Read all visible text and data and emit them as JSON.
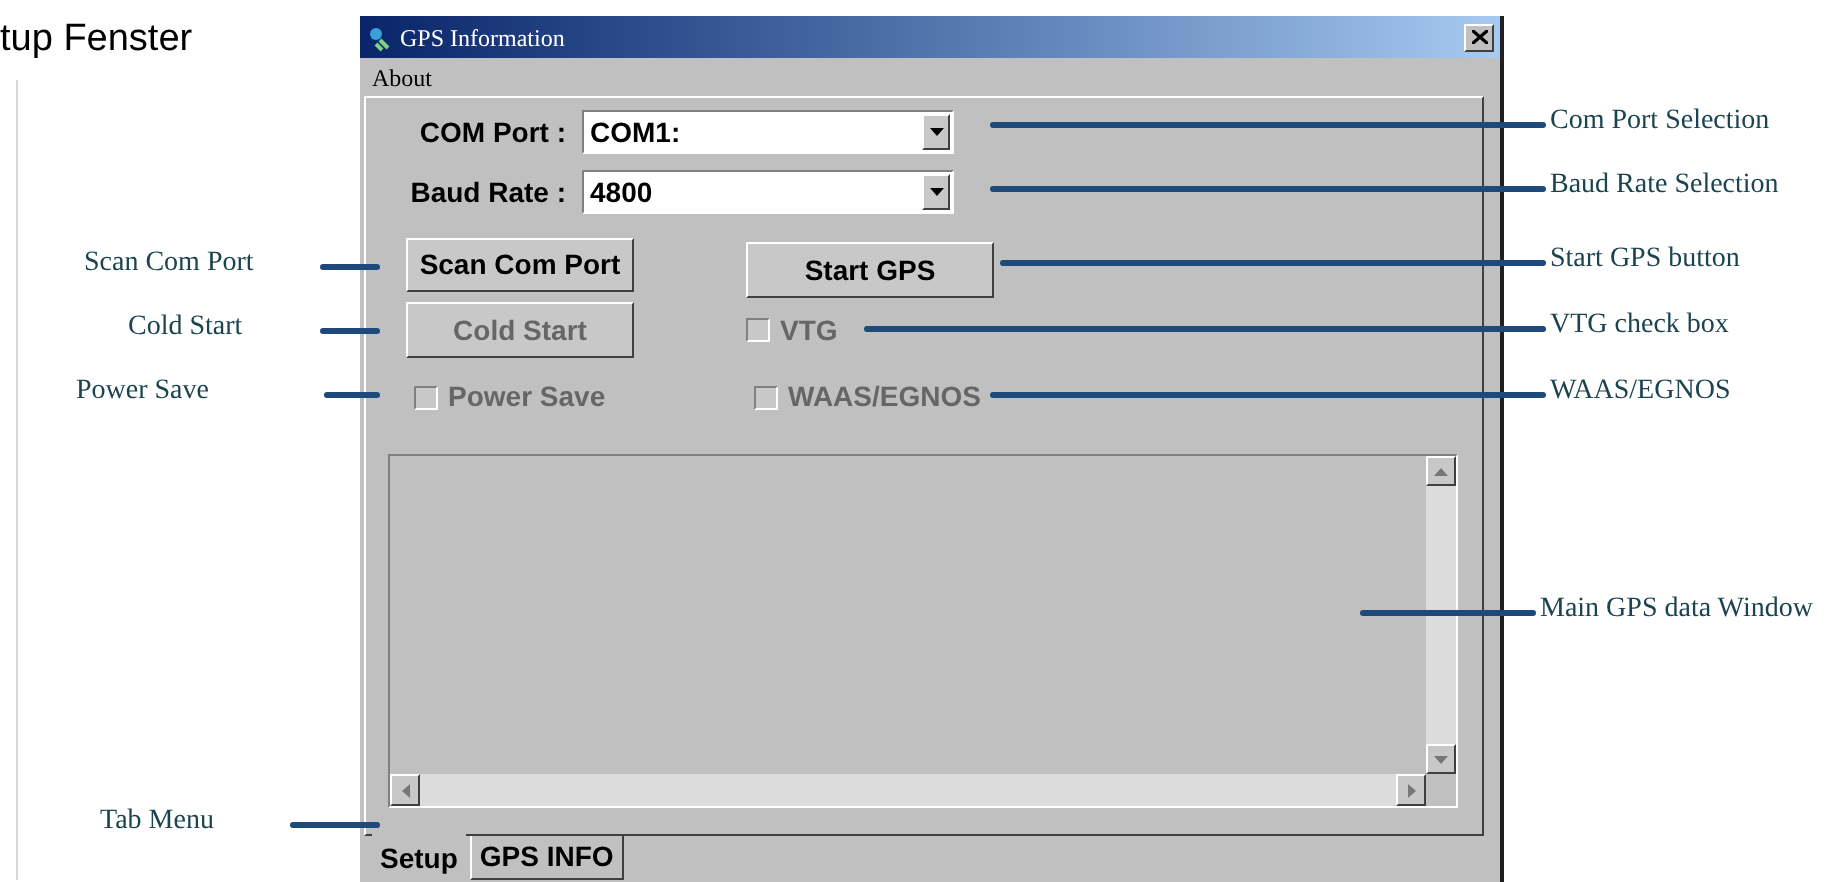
{
  "page_heading": "tup Fenster",
  "window": {
    "title": "GPS Information",
    "menu": [
      "About"
    ],
    "fields": [
      {
        "label": "COM Port :",
        "value": "COM1:"
      },
      {
        "label": "Baud Rate :",
        "value": "4800"
      }
    ],
    "buttons": [
      {
        "label": "Scan Com Port",
        "disabled": false
      },
      {
        "label": "Start GPS",
        "disabled": false
      },
      {
        "label": "Cold Start",
        "disabled": true
      }
    ],
    "checkboxes": [
      {
        "label": "VTG",
        "checked": false,
        "disabled": true
      },
      {
        "label": "Power Save",
        "checked": false,
        "disabled": true
      },
      {
        "label": "WAAS/EGNOS",
        "checked": false,
        "disabled": true
      }
    ],
    "tabs": [
      {
        "label": "Setup",
        "selected": true
      },
      {
        "label": "GPS INFO",
        "selected": false
      }
    ]
  },
  "callouts": [
    {
      "kind": "left",
      "label": "Scan Com Port"
    },
    {
      "kind": "left",
      "label": "Cold Start"
    },
    {
      "kind": "left",
      "label": "Power Save"
    },
    {
      "kind": "left",
      "label": "Tab Menu"
    },
    {
      "kind": "right",
      "label": "Com Port Selection"
    },
    {
      "kind": "right",
      "label": "Baud Rate Selection"
    },
    {
      "kind": "right",
      "label": "Start GPS button"
    },
    {
      "kind": "right",
      "label": "VTG check box"
    },
    {
      "kind": "right",
      "label": "WAAS/EGNOS"
    },
    {
      "kind": "right",
      "label": "Main GPS data Window"
    }
  ]
}
